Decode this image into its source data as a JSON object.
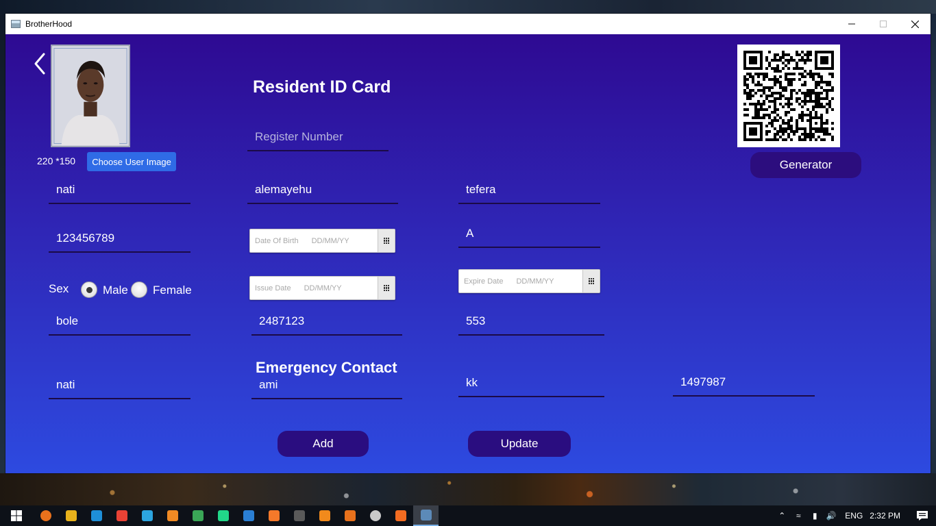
{
  "window": {
    "title": "BrotherHood"
  },
  "form": {
    "title": "Resident ID Card",
    "photo_size_label": "220 *150",
    "choose_image_label": "Choose User Image",
    "generator_label": "Generator",
    "register_number_placeholder": "Register Number",
    "first_name": "nati",
    "middle_name": "alemayehu",
    "last_name": "tefera",
    "phone": "123456789",
    "blood_type": "A",
    "date_of_birth": {
      "label": "Date Of Birth",
      "hint": "DD/MM/YY"
    },
    "issue_date": {
      "label": "Issue Date",
      "hint": "DD/MM/YY"
    },
    "expire_date": {
      "label": "Expire Date",
      "hint": "DD/MM/YY"
    },
    "sex": {
      "label": "Sex",
      "options": [
        "Male",
        "Female"
      ],
      "selected": "Male"
    },
    "subcity": "bole",
    "house_number": "2487123",
    "kebele": "553"
  },
  "emergency": {
    "title": "Emergency Contact",
    "first_name": "nati",
    "middle_name": "ami",
    "last_name": "kk",
    "phone": "1497987"
  },
  "actions": {
    "add_label": "Add",
    "update_label": "Update"
  },
  "taskbar": {
    "language": "ENG",
    "time": "2:32 PM",
    "apps": [
      "chrome-canary-icon",
      "file-explorer-icon",
      "edge-icon",
      "chrome-icon",
      "telegram-icon",
      "sublime-icon",
      "app-icon",
      "pycharm-icon",
      "vscode-icon",
      "blender-icon",
      "intellij-icon",
      "vlc-icon",
      "search-app-icon",
      "obs-icon",
      "xampp-icon",
      "java-app-icon"
    ]
  },
  "colors": {
    "gradient_top": "#2e0a92",
    "gradient_bottom": "#2d4ae0",
    "button_dark": "#2a0d80",
    "choose_button": "#2f6be6"
  }
}
